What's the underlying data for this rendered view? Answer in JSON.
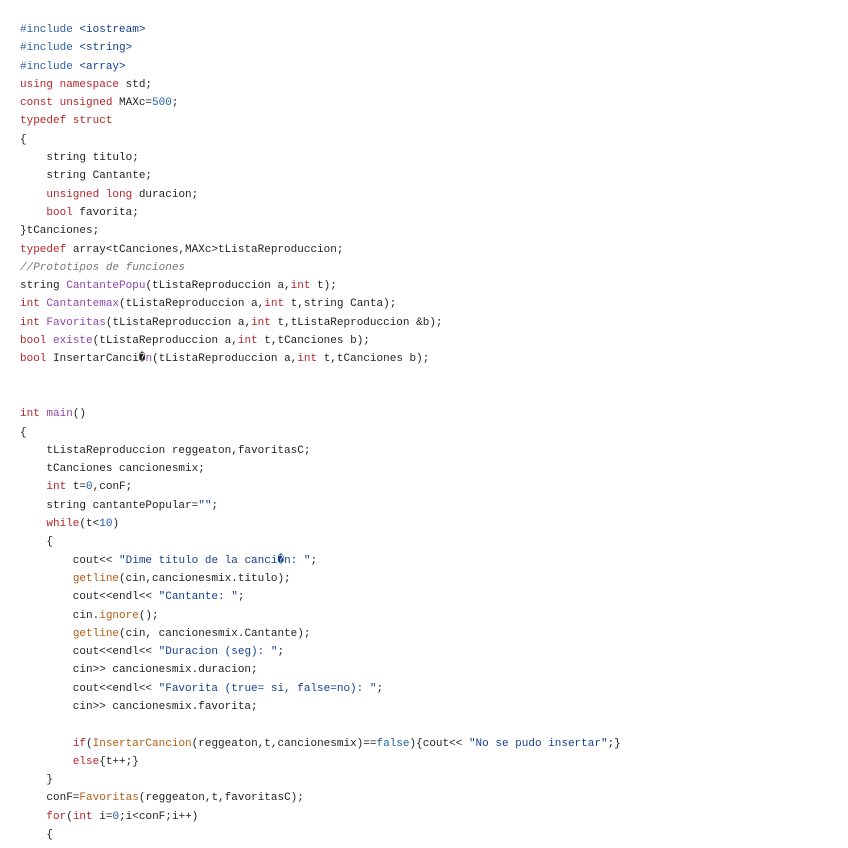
{
  "document": {
    "language": "C++",
    "lines": [
      [
        [
          "pp",
          "#include "
        ],
        [
          "str",
          "<iostream>"
        ]
      ],
      [
        [
          "pp",
          "#include "
        ],
        [
          "str",
          "<string>"
        ]
      ],
      [
        [
          "pp",
          "#include "
        ],
        [
          "str",
          "<array>"
        ]
      ],
      [
        [
          "kw",
          "using namespace"
        ],
        [
          "plain",
          " std;"
        ]
      ],
      [
        [
          "kw",
          "const unsigned"
        ],
        [
          "plain",
          " MAXc="
        ],
        [
          "num",
          "500"
        ],
        [
          "plain",
          ";"
        ]
      ],
      [
        [
          "kw",
          "typedef struct"
        ]
      ],
      [
        [
          "plain",
          "{"
        ]
      ],
      [
        [
          "plain",
          "    string titulo;"
        ]
      ],
      [
        [
          "plain",
          "    string Cantante;"
        ]
      ],
      [
        [
          "plain",
          "    "
        ],
        [
          "kw",
          "unsigned long"
        ],
        [
          "plain",
          " duracion;"
        ]
      ],
      [
        [
          "plain",
          "    "
        ],
        [
          "kw",
          "bool"
        ],
        [
          "plain",
          " favorita;"
        ]
      ],
      [
        [
          "plain",
          "}tCanciones;"
        ]
      ],
      [
        [
          "kw",
          "typedef"
        ],
        [
          "plain",
          " array<tCanciones,MAXc>tListaReproduccion;"
        ]
      ],
      [
        [
          "com",
          "//Prototipos de funciones"
        ]
      ],
      [
        [
          "plain",
          "string "
        ],
        [
          "fn",
          "CantantePopu"
        ],
        [
          "plain",
          "(tListaReproduccion a,"
        ],
        [
          "kw",
          "int"
        ],
        [
          "plain",
          " t);"
        ]
      ],
      [
        [
          "kw",
          "int"
        ],
        [
          "plain",
          " "
        ],
        [
          "fn",
          "Cantantemax"
        ],
        [
          "plain",
          "(tListaReproduccion a,"
        ],
        [
          "kw",
          "int"
        ],
        [
          "plain",
          " t,string Canta);"
        ]
      ],
      [
        [
          "kw",
          "int"
        ],
        [
          "plain",
          " "
        ],
        [
          "fn",
          "Favoritas"
        ],
        [
          "plain",
          "(tListaReproduccion a,"
        ],
        [
          "kw",
          "int"
        ],
        [
          "plain",
          " t,tListaReproduccion &b);"
        ]
      ],
      [
        [
          "kw",
          "bool"
        ],
        [
          "plain",
          " "
        ],
        [
          "fn",
          "existe"
        ],
        [
          "plain",
          "(tListaReproduccion a,"
        ],
        [
          "kw",
          "int"
        ],
        [
          "plain",
          " t,tCanciones b);"
        ]
      ],
      [
        [
          "kw",
          "bool"
        ],
        [
          "plain",
          " InsertarCanci�"
        ],
        [
          "fn",
          "n"
        ],
        [
          "plain",
          "(tListaReproduccion a,"
        ],
        [
          "kw",
          "int"
        ],
        [
          "plain",
          " t,tCanciones b);"
        ]
      ],
      [],
      [],
      [
        [
          "kw",
          "int"
        ],
        [
          "plain",
          " "
        ],
        [
          "fn",
          "main"
        ],
        [
          "plain",
          "()"
        ]
      ],
      [
        [
          "plain",
          "{"
        ]
      ],
      [
        [
          "plain",
          "    tListaReproduccion reggeaton,favoritasC;"
        ]
      ],
      [
        [
          "plain",
          "    tCanciones cancionesmix;"
        ]
      ],
      [
        [
          "plain",
          "    "
        ],
        [
          "kw",
          "int"
        ],
        [
          "plain",
          " t="
        ],
        [
          "num",
          "0"
        ],
        [
          "plain",
          ",conF;"
        ]
      ],
      [
        [
          "plain",
          "    string cantantePopular="
        ],
        [
          "str",
          "\"\""
        ],
        [
          "plain",
          ";"
        ]
      ],
      [
        [
          "plain",
          "    "
        ],
        [
          "kw",
          "while"
        ],
        [
          "plain",
          "(t<"
        ],
        [
          "num",
          "10"
        ],
        [
          "plain",
          ")"
        ]
      ],
      [
        [
          "plain",
          "    {"
        ]
      ],
      [
        [
          "plain",
          "        cout<< "
        ],
        [
          "str",
          "\"Dime titulo de la canci�n: \""
        ],
        [
          "plain",
          ";"
        ]
      ],
      [
        [
          "plain",
          "        "
        ],
        [
          "call",
          "getline"
        ],
        [
          "plain",
          "(cin,cancionesmix.titulo);"
        ]
      ],
      [
        [
          "plain",
          "        cout<<endl<< "
        ],
        [
          "str",
          "\"Cantante: \""
        ],
        [
          "plain",
          ";"
        ]
      ],
      [
        [
          "plain",
          "        cin."
        ],
        [
          "call",
          "ignore"
        ],
        [
          "plain",
          "();"
        ]
      ],
      [
        [
          "plain",
          "        "
        ],
        [
          "call",
          "getline"
        ],
        [
          "plain",
          "(cin, cancionesmix.Cantante);"
        ]
      ],
      [
        [
          "plain",
          "        cout<<endl<< "
        ],
        [
          "str",
          "\"Duracion (seg): \""
        ],
        [
          "plain",
          ";"
        ]
      ],
      [
        [
          "plain",
          "        cin>> cancionesmix.duracion;"
        ]
      ],
      [
        [
          "plain",
          "        cout<<endl<< "
        ],
        [
          "str",
          "\"Favorita (true= si, false=no): \""
        ],
        [
          "plain",
          ";"
        ]
      ],
      [
        [
          "plain",
          "        cin>> cancionesmix.favorita;"
        ]
      ],
      [],
      [
        [
          "plain",
          "        "
        ],
        [
          "kw",
          "if"
        ],
        [
          "plain",
          "("
        ],
        [
          "call",
          "InsertarCancion"
        ],
        [
          "plain",
          "(reggeaton,t,cancionesmix)=="
        ],
        [
          "num",
          "false"
        ],
        [
          "plain",
          "){cout<< "
        ],
        [
          "str",
          "\"No se pudo insertar\""
        ],
        [
          "plain",
          ";}"
        ]
      ],
      [
        [
          "plain",
          "        "
        ],
        [
          "kw",
          "else"
        ],
        [
          "plain",
          "{t++;}"
        ]
      ],
      [
        [
          "plain",
          "    }"
        ]
      ],
      [
        [
          "plain",
          "    conF="
        ],
        [
          "call",
          "Favoritas"
        ],
        [
          "plain",
          "(reggeaton,t,favoritasC);"
        ]
      ],
      [
        [
          "plain",
          "    "
        ],
        [
          "kw",
          "for"
        ],
        [
          "plain",
          "("
        ],
        [
          "kw",
          "int"
        ],
        [
          "plain",
          " i="
        ],
        [
          "num",
          "0"
        ],
        [
          "plain",
          ";i<conF;i++)"
        ]
      ],
      [
        [
          "plain",
          "    {"
        ]
      ]
    ]
  }
}
